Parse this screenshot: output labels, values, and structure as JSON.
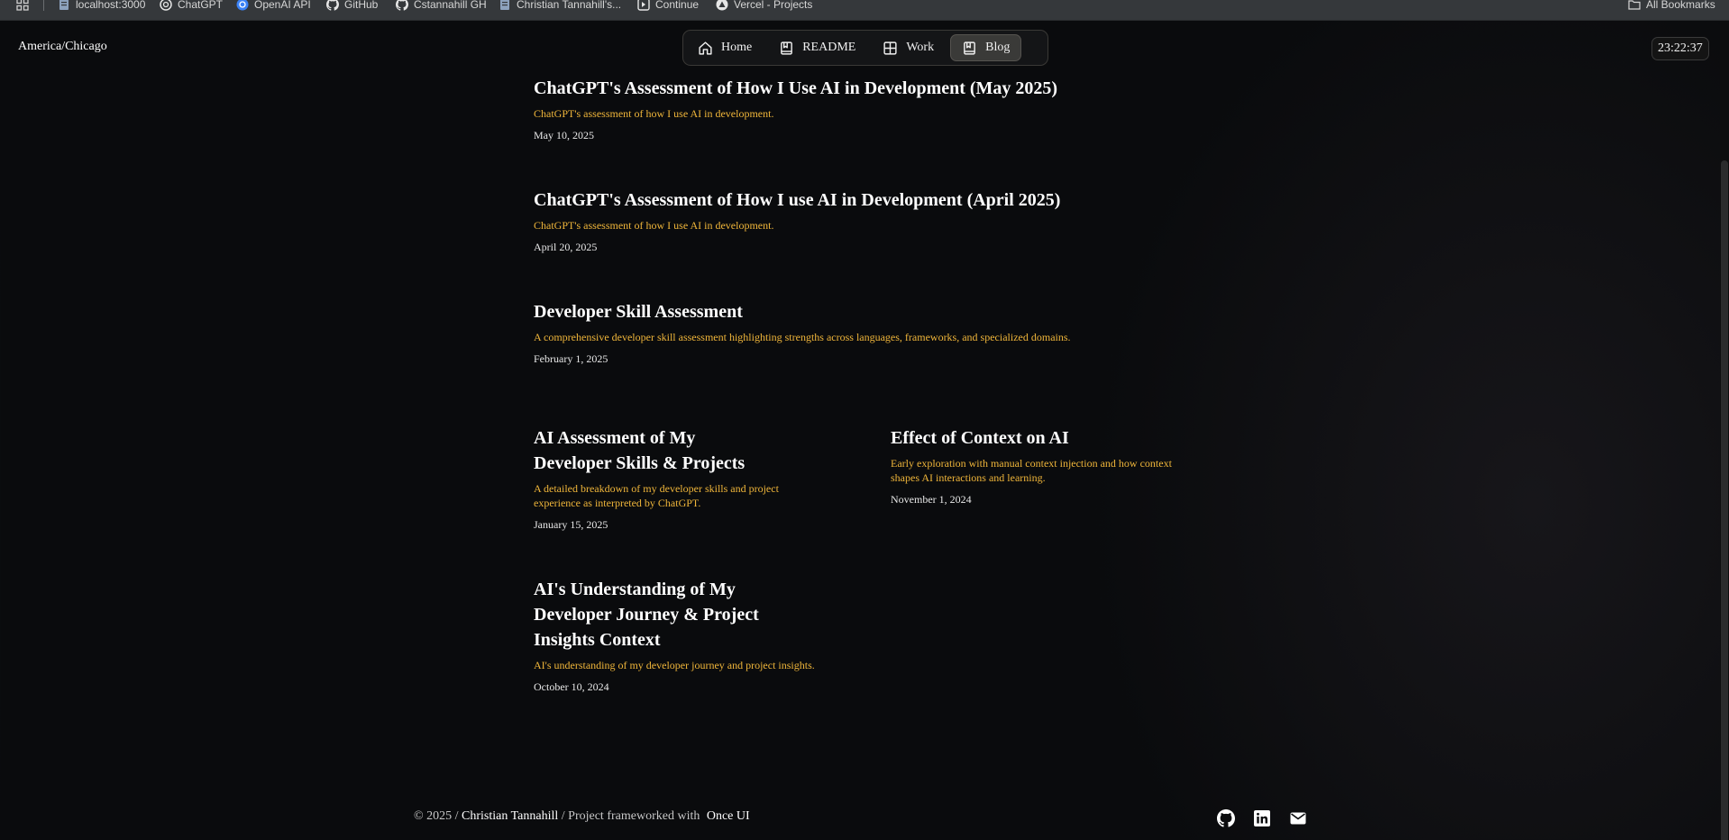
{
  "bookmarks": {
    "apps_icon": "apps-grid-icon",
    "items": [
      {
        "label": "localhost:3000",
        "icon": "page-icon"
      },
      {
        "label": "ChatGPT",
        "icon": "openai-icon"
      },
      {
        "label": "OpenAI API",
        "icon": "openai-icon"
      },
      {
        "label": "GitHub",
        "icon": "github-icon"
      },
      {
        "label": "Cstannahill GH",
        "icon": "github-icon"
      },
      {
        "label": "Christian Tannahill's...",
        "icon": "page-icon"
      },
      {
        "label": "Continue",
        "icon": "continue-icon"
      },
      {
        "label": "Vercel - Projects",
        "icon": "vercel-icon"
      }
    ],
    "all_bookmarks": "All Bookmarks"
  },
  "header": {
    "timezone": "America/Chicago",
    "time": "23:22:37",
    "nav": [
      {
        "label": "Home",
        "icon": "home-icon",
        "active": false
      },
      {
        "label": "README",
        "icon": "book-icon",
        "active": false
      },
      {
        "label": "Work",
        "icon": "grid-icon",
        "active": false
      },
      {
        "label": "Blog",
        "icon": "book-icon",
        "active": true
      }
    ]
  },
  "posts": [
    {
      "title": "ChatGPT's Assessment of How I Use AI in Development (May 2025)",
      "description": "ChatGPT's assessment of how I use AI in development.",
      "date": "May 10, 2025"
    },
    {
      "title": "ChatGPT's Assessment of How I use AI in Development (April 2025)",
      "description": "ChatGPT's assessment of how I use AI in development.",
      "date": "April 20, 2025"
    },
    {
      "title": "Developer Skill Assessment",
      "description": "A comprehensive developer skill assessment highlighting strengths across languages, frameworks, and specialized domains.",
      "date": "February 1, 2025"
    },
    {
      "title": "AI Assessment of My Developer Skills & Projects",
      "description": "A detailed breakdown of my developer skills and project experience as interpreted by ChatGPT.",
      "date": "January 15, 2025"
    },
    {
      "title": "Effect of Context on AI",
      "description": "Early exploration with manual context injection and how context shapes AI interactions and learning.",
      "date": "November 1, 2024"
    },
    {
      "title": "AI's Understanding of My Developer Journey & Project Insights Context",
      "description": "AI's understanding of my developer journey and project insights.",
      "date": "October 10, 2024"
    }
  ],
  "footer": {
    "copyright": "© 2025 /",
    "author": "Christian Tannahill",
    "middle": "/ Project frameworked with",
    "framework": "Once UI",
    "social": [
      "github-icon",
      "linkedin-icon",
      "email-icon"
    ]
  },
  "colors": {
    "background": "#0a0b0d",
    "accent_description": "#f0b63a",
    "title": "#ffffff"
  }
}
